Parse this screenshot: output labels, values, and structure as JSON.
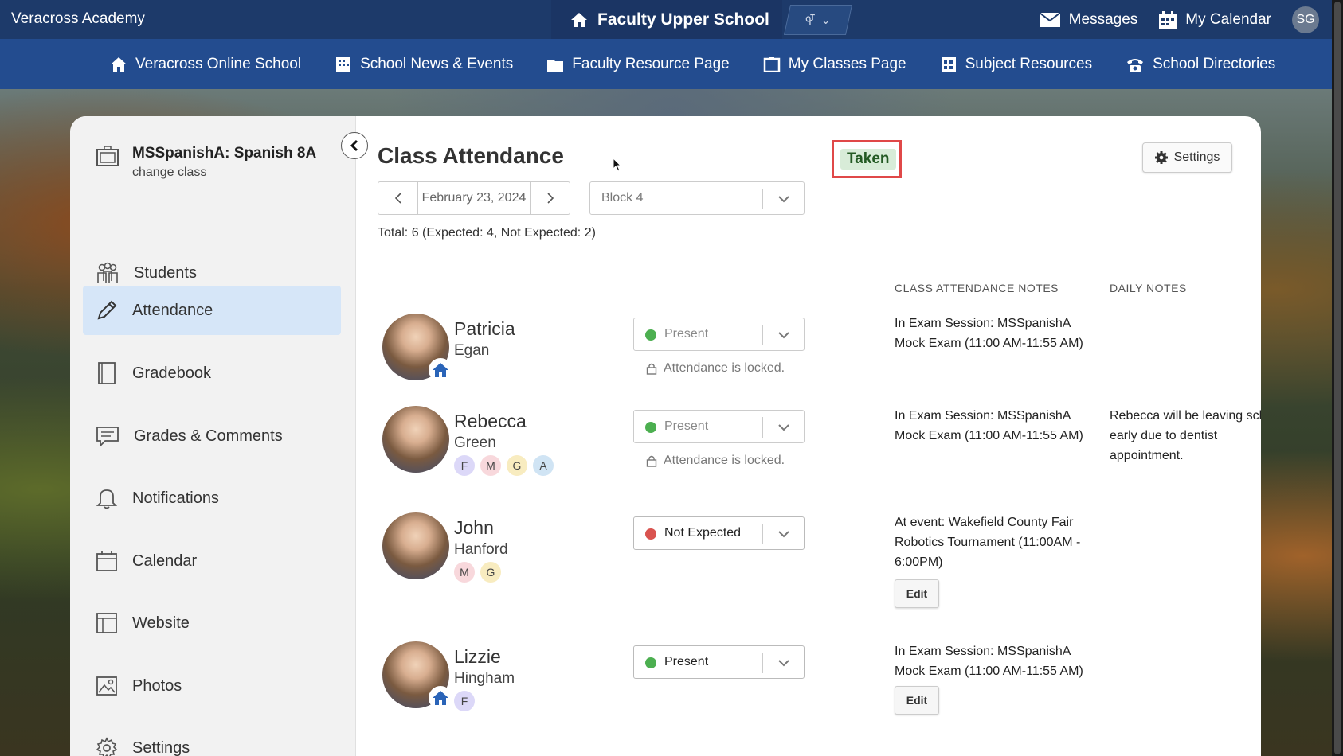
{
  "topbar": {
    "school_name": "Veracross Academy",
    "portal_label": "Faculty Upper School",
    "messages_label": "Messages",
    "calendar_label": "My Calendar",
    "user_initials": "SG"
  },
  "nav": {
    "items": [
      {
        "label": "Veracross Online School",
        "icon": "home-icon"
      },
      {
        "label": "School News & Events",
        "icon": "building-icon"
      },
      {
        "label": "Faculty Resource Page",
        "icon": "folder-icon"
      },
      {
        "label": "My Classes Page",
        "icon": "classroom-icon"
      },
      {
        "label": "Subject Resources",
        "icon": "grid-building-icon"
      },
      {
        "label": "School Directories",
        "icon": "phone-icon"
      }
    ]
  },
  "sidebar": {
    "class_name": "MSSpanishA: Spanish 8A",
    "change_class": "change class",
    "items": [
      {
        "label": "Students",
        "icon": "students-icon"
      },
      {
        "label": "Attendance",
        "icon": "pencil-icon",
        "active": true
      },
      {
        "label": "Gradebook",
        "icon": "book-icon"
      },
      {
        "label": "Grades & Comments",
        "icon": "comment-icon"
      },
      {
        "label": "Notifications",
        "icon": "bell-icon"
      },
      {
        "label": "Calendar",
        "icon": "calendar-icon"
      },
      {
        "label": "Website",
        "icon": "website-icon"
      },
      {
        "label": "Photos",
        "icon": "photo-icon"
      },
      {
        "label": "Settings",
        "icon": "gear-icon"
      }
    ]
  },
  "main": {
    "title": "Class Attendance",
    "status_badge": "Taken",
    "settings_label": "Settings",
    "date": "February 23, 2024",
    "block": "Block 4",
    "total": "Total: 6 (Expected: 4, Not Expected: 2)",
    "col_class_notes": "CLASS ATTENDANCE NOTES",
    "col_daily_notes": "DAILY NOTES"
  },
  "students": [
    {
      "first": "Patricia",
      "last": "Egan",
      "status": "Present",
      "status_color": "#4caf50",
      "locked": true,
      "lock_msg": "Attendance is locked.",
      "note": "In Exam Session: MSSpanishA Mock Exam (11:00 AM-11:55 AM)",
      "daily": "",
      "tags": [],
      "home": true
    },
    {
      "first": "Rebecca",
      "last": "Green",
      "status": "Present",
      "status_color": "#4caf50",
      "locked": true,
      "lock_msg": "Attendance is locked.",
      "note": "In Exam Session: MSSpanishA Mock Exam (11:00 AM-11:55 AM)",
      "daily": "Rebecca will be leaving school early due to dentist appointment.",
      "tags": [
        "F",
        "M",
        "G",
        "A"
      ],
      "home": false
    },
    {
      "first": "John",
      "last": "Hanford",
      "status": "Not Expected",
      "status_color": "#d9534f",
      "locked": false,
      "note": "At event: Wakefield County Fair Robotics Tournament (11:00AM - 6:00PM)",
      "daily": "",
      "tags": [
        "M",
        "G"
      ],
      "home": false,
      "edit": "Edit"
    },
    {
      "first": "Lizzie",
      "last": "Hingham",
      "status": "Present",
      "status_color": "#4caf50",
      "locked": false,
      "note": "In Exam Session: MSSpanishA Mock Exam (11:00 AM-11:55 AM)",
      "daily": "",
      "tags": [
        "F"
      ],
      "home": true,
      "edit": "Edit"
    }
  ]
}
